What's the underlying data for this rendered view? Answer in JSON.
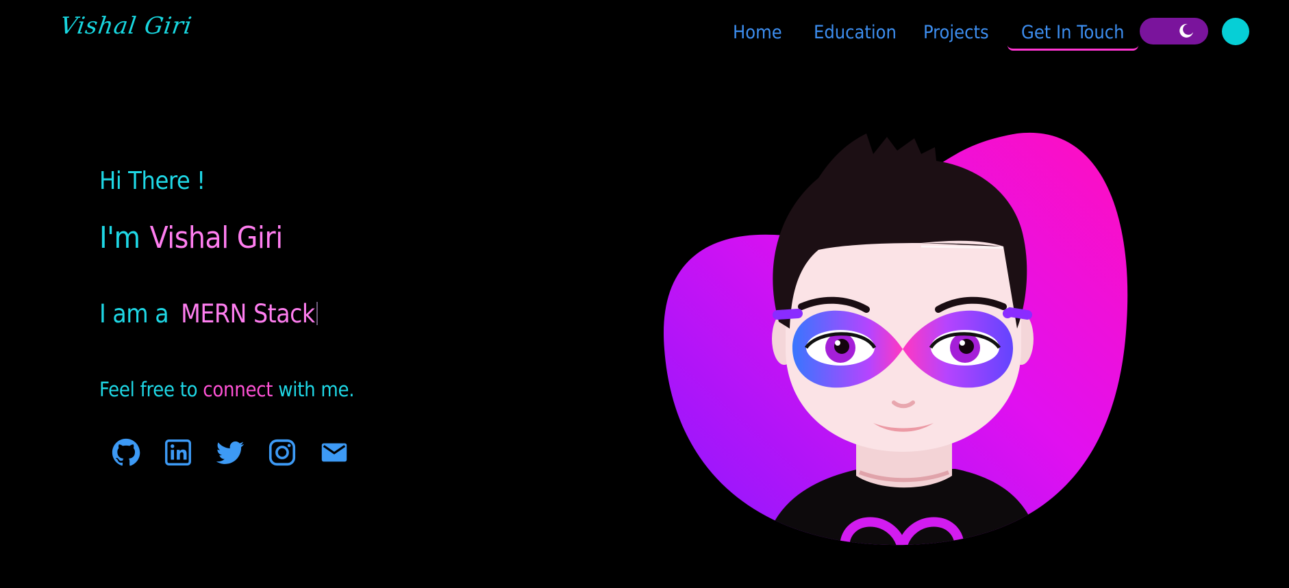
{
  "logo": "Vishal Giri",
  "nav": {
    "home": "Home",
    "education": "Education",
    "projects": "Projects",
    "contact": "Get In Touch"
  },
  "theme_toggle": {
    "icon": "moon-icon",
    "state": "dark"
  },
  "hero": {
    "greeting": "Hi There !",
    "im": "I'm",
    "name": "Vishal Giri",
    "iam": "I am a",
    "role": "MERN Stack",
    "connect_pre": "Feel free to",
    "connect_link": "connect",
    "connect_post": "with me."
  },
  "socials": [
    "github-icon",
    "linkedin-icon",
    "twitter-icon",
    "instagram-icon",
    "mail-icon"
  ],
  "colors": {
    "background": "#000000",
    "cyan": "#1fd8e6",
    "pink": "#ff7ef0",
    "magenta": "#ff35d2",
    "nav_blue": "#3d8ef0",
    "toggle_purple": "#7a149c"
  }
}
